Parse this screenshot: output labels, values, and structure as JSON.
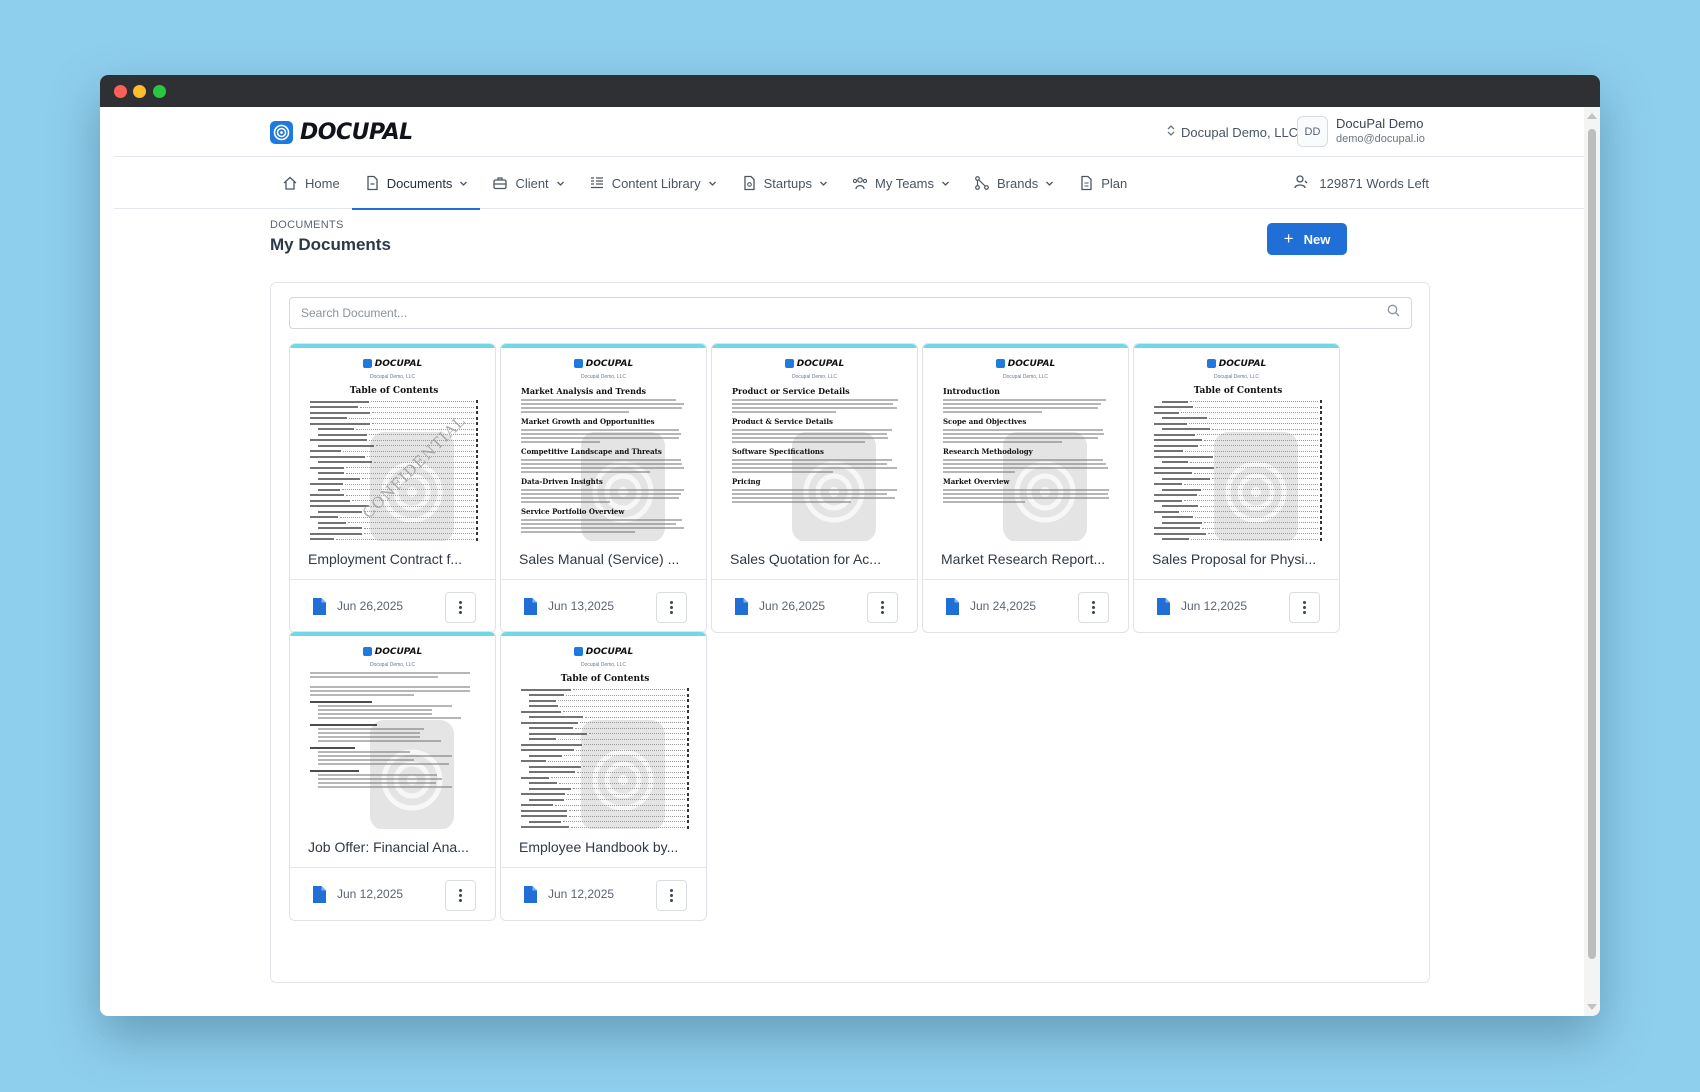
{
  "brand": {
    "name": "DOCUPAL",
    "accent": "#1f6fd6"
  },
  "header": {
    "org_name": "Docupal Demo, LLC",
    "avatar_initials": "DD",
    "user_name": "DocuPal Demo",
    "user_email": "demo@docupal.io"
  },
  "nav": {
    "items": [
      {
        "label": "Home",
        "icon": "home-icon",
        "has_caret": false,
        "active": false
      },
      {
        "label": "Documents",
        "icon": "document-icon",
        "has_caret": true,
        "active": true
      },
      {
        "label": "Client",
        "icon": "briefcase-icon",
        "has_caret": true,
        "active": false
      },
      {
        "label": "Content Library",
        "icon": "library-icon",
        "has_caret": true,
        "active": false
      },
      {
        "label": "Startups",
        "icon": "startup-icon",
        "has_caret": true,
        "active": false
      },
      {
        "label": "My Teams",
        "icon": "team-icon",
        "has_caret": true,
        "active": false
      },
      {
        "label": "Brands",
        "icon": "brands-icon",
        "has_caret": true,
        "active": false
      },
      {
        "label": "Plan",
        "icon": "plan-icon",
        "has_caret": false,
        "active": false
      }
    ],
    "words_left": "129871 Words Left"
  },
  "page": {
    "breadcrumb": "DOCUMENTS",
    "title": "My Documents",
    "new_button_label": "New"
  },
  "search": {
    "placeholder": "Search Document..."
  },
  "documents": [
    {
      "title": "Employment Contract f...",
      "date": "Jun 26,2025",
      "thumbnail": {
        "brand": "DOCUPAL",
        "subtitle": "Docupal Demo, LLC",
        "heading": "Table of Contents",
        "layout": "toc",
        "stamp": "CONFIDENTIAL"
      }
    },
    {
      "title": "Sales Manual (Service) ...",
      "date": "Jun 13,2025",
      "thumbnail": {
        "brand": "DOCUPAL",
        "subtitle": "Docupal Demo, LLC",
        "heading": "Market Analysis and Trends",
        "layout": "prose",
        "sections": [
          "Market Growth and Opportunities",
          "Competitive Landscape and Threats",
          "Data-Driven Insights",
          "Service Portfolio Overview"
        ]
      }
    },
    {
      "title": "Sales Quotation for Ac...",
      "date": "Jun 26,2025",
      "thumbnail": {
        "brand": "DOCUPAL",
        "subtitle": "Docupal Demo, LLC",
        "heading": "Product or Service Details",
        "layout": "prose",
        "sections": [
          "Product & Service Details",
          "Software Specifications",
          "Pricing"
        ]
      }
    },
    {
      "title": "Market Research Report...",
      "date": "Jun 24,2025",
      "thumbnail": {
        "brand": "DOCUPAL",
        "subtitle": "Docupal Demo, LLC",
        "heading": "Introduction",
        "layout": "prose",
        "sections": [
          "Scope and Objectives",
          "Research Methodology",
          "Market Overview"
        ]
      }
    },
    {
      "title": "Sales Proposal for Physi...",
      "date": "Jun 12,2025",
      "thumbnail": {
        "brand": "DOCUPAL",
        "subtitle": "Docupal Demo, LLC",
        "heading": "Table of Contents",
        "layout": "toc"
      }
    },
    {
      "title": "Job Offer: Financial Ana...",
      "date": "Jun 12,2025",
      "thumbnail": {
        "brand": "DOCUPAL",
        "subtitle": "Docupal Demo, LLC",
        "heading": "",
        "layout": "letter"
      }
    },
    {
      "title": "Employee Handbook by...",
      "date": "Jun 12,2025",
      "thumbnail": {
        "brand": "DOCUPAL",
        "subtitle": "Docupal Demo, LLC",
        "heading": "Table of Contents",
        "layout": "toc"
      }
    }
  ]
}
